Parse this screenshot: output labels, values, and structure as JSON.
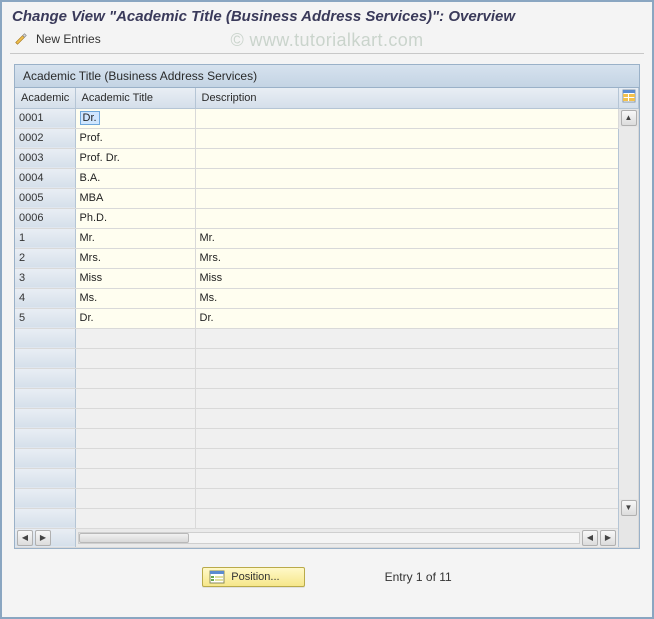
{
  "title": "Change View \"Academic Title (Business Address Services)\": Overview",
  "toolbar": {
    "new_entries_label": "New Entries"
  },
  "watermark": "© www.tutorialkart.com",
  "panel": {
    "header": "Academic Title (Business Address Services)",
    "columns": {
      "code": "Academic",
      "title": "Academic Title",
      "desc": "Description"
    },
    "rows": [
      {
        "code": "0001",
        "title": "Dr.",
        "desc": ""
      },
      {
        "code": "0002",
        "title": "Prof.",
        "desc": ""
      },
      {
        "code": "0003",
        "title": "Prof. Dr.",
        "desc": ""
      },
      {
        "code": "0004",
        "title": "B.A.",
        "desc": ""
      },
      {
        "code": "0005",
        "title": "MBA",
        "desc": ""
      },
      {
        "code": "0006",
        "title": "Ph.D.",
        "desc": ""
      },
      {
        "code": "1",
        "title": "Mr.",
        "desc": "Mr."
      },
      {
        "code": "2",
        "title": "Mrs.",
        "desc": "Mrs."
      },
      {
        "code": "3",
        "title": "Miss",
        "desc": "Miss"
      },
      {
        "code": "4",
        "title": "Ms.",
        "desc": "Ms."
      },
      {
        "code": "5",
        "title": "Dr.",
        "desc": "Dr."
      }
    ],
    "empty_row_count": 10
  },
  "footer": {
    "position_label": "Position...",
    "entry_status": "Entry 1 of 11"
  }
}
